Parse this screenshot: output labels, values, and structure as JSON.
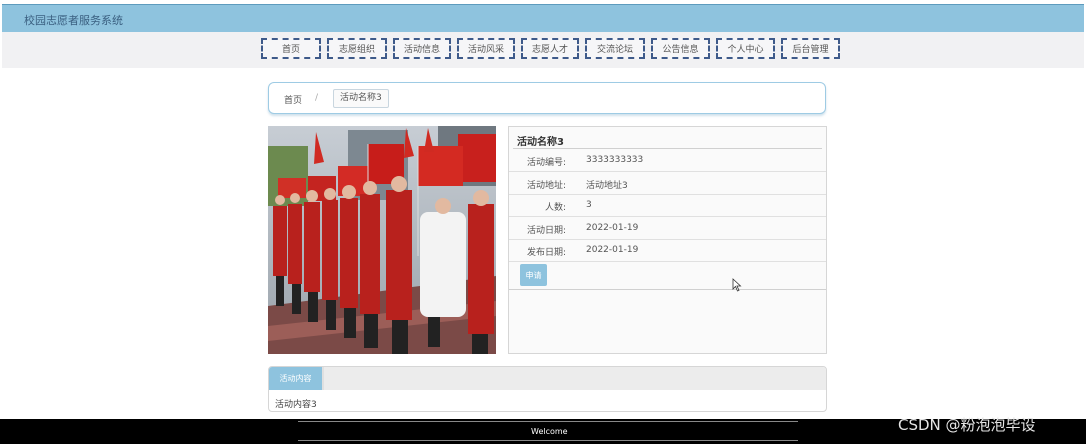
{
  "header": {
    "site_title": "校园志愿者服务系统"
  },
  "nav": {
    "items": [
      {
        "label": "首页"
      },
      {
        "label": "志愿组织"
      },
      {
        "label": "活动信息"
      },
      {
        "label": "活动风采"
      },
      {
        "label": "志愿人才"
      },
      {
        "label": "交流论坛"
      },
      {
        "label": "公告信息"
      },
      {
        "label": "个人中心"
      },
      {
        "label": "后台管理"
      }
    ]
  },
  "breadcrumb": {
    "home": "首页",
    "separator": "/",
    "current": "活动名称3"
  },
  "detail": {
    "title": "活动名称3",
    "rows": [
      {
        "label": "活动编号:",
        "value": "3333333333"
      },
      {
        "label": "活动地址:",
        "value": "活动地址3"
      },
      {
        "label": "人数:",
        "value": "3"
      },
      {
        "label": "活动日期:",
        "value": "2022-01-19"
      },
      {
        "label": "发布日期:",
        "value": "2022-01-19"
      }
    ],
    "apply_button": "申请"
  },
  "photo": {
    "icon": "volunteer-group-photo"
  },
  "content": {
    "tab_label": "活动内容",
    "text": "活动内容3"
  },
  "footer": {
    "text": "Welcome"
  },
  "watermark": "CSDN @粉泡泡毕设",
  "colors": {
    "accent": "#8ec3de",
    "nav_border": "#3e5a8a",
    "footer_bg": "#000000"
  }
}
